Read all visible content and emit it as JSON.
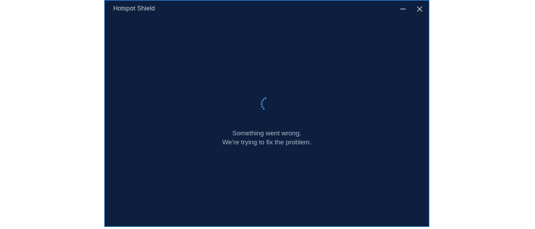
{
  "window": {
    "title": "Hotspot Shield",
    "accent_color": "#2a74c6",
    "background_color": "#0d1f3e"
  },
  "controls": {
    "minimize_icon": "minimize-icon",
    "close_icon": "close-icon"
  },
  "status": {
    "spinner_icon": "loading-spinner-icon",
    "spinner_color": "#3d8fe0",
    "line1": "Something went wrong.",
    "line2": "We're trying to fix the problem."
  }
}
